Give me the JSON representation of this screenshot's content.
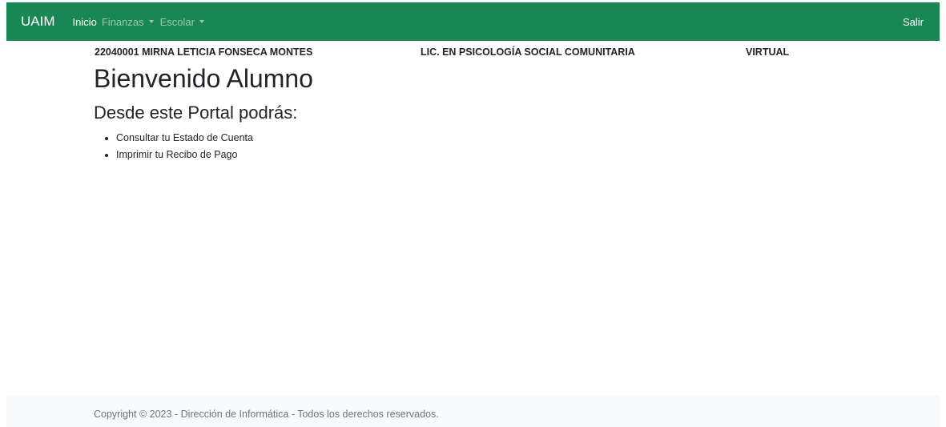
{
  "navbar": {
    "brand": "UAIM",
    "items": [
      {
        "label": "Inicio",
        "active": true
      },
      {
        "label": "Finanzas",
        "dropdown": true
      },
      {
        "label": "Escolar",
        "dropdown": true
      }
    ],
    "logout_label": "Salir",
    "background_color": "#198754"
  },
  "student": {
    "id_name": "22040001 MIRNA LETICIA FONSECA MONTES",
    "career": "LIC. EN PSICOLOGÍA SOCIAL COMUNITARIA",
    "modality": "VIRTUAL"
  },
  "main": {
    "welcome": "Bienvenido Alumno",
    "subtitle": "Desde este Portal podrás:",
    "features": [
      "Consultar tu Estado de Cuenta",
      "Imprimir tu Recibo de Pago"
    ]
  },
  "footer": {
    "copyright": "Copyright © 2023 - Dirección de Informática - Todos los derechos reservados.",
    "background_color": "#f8f9fa"
  }
}
